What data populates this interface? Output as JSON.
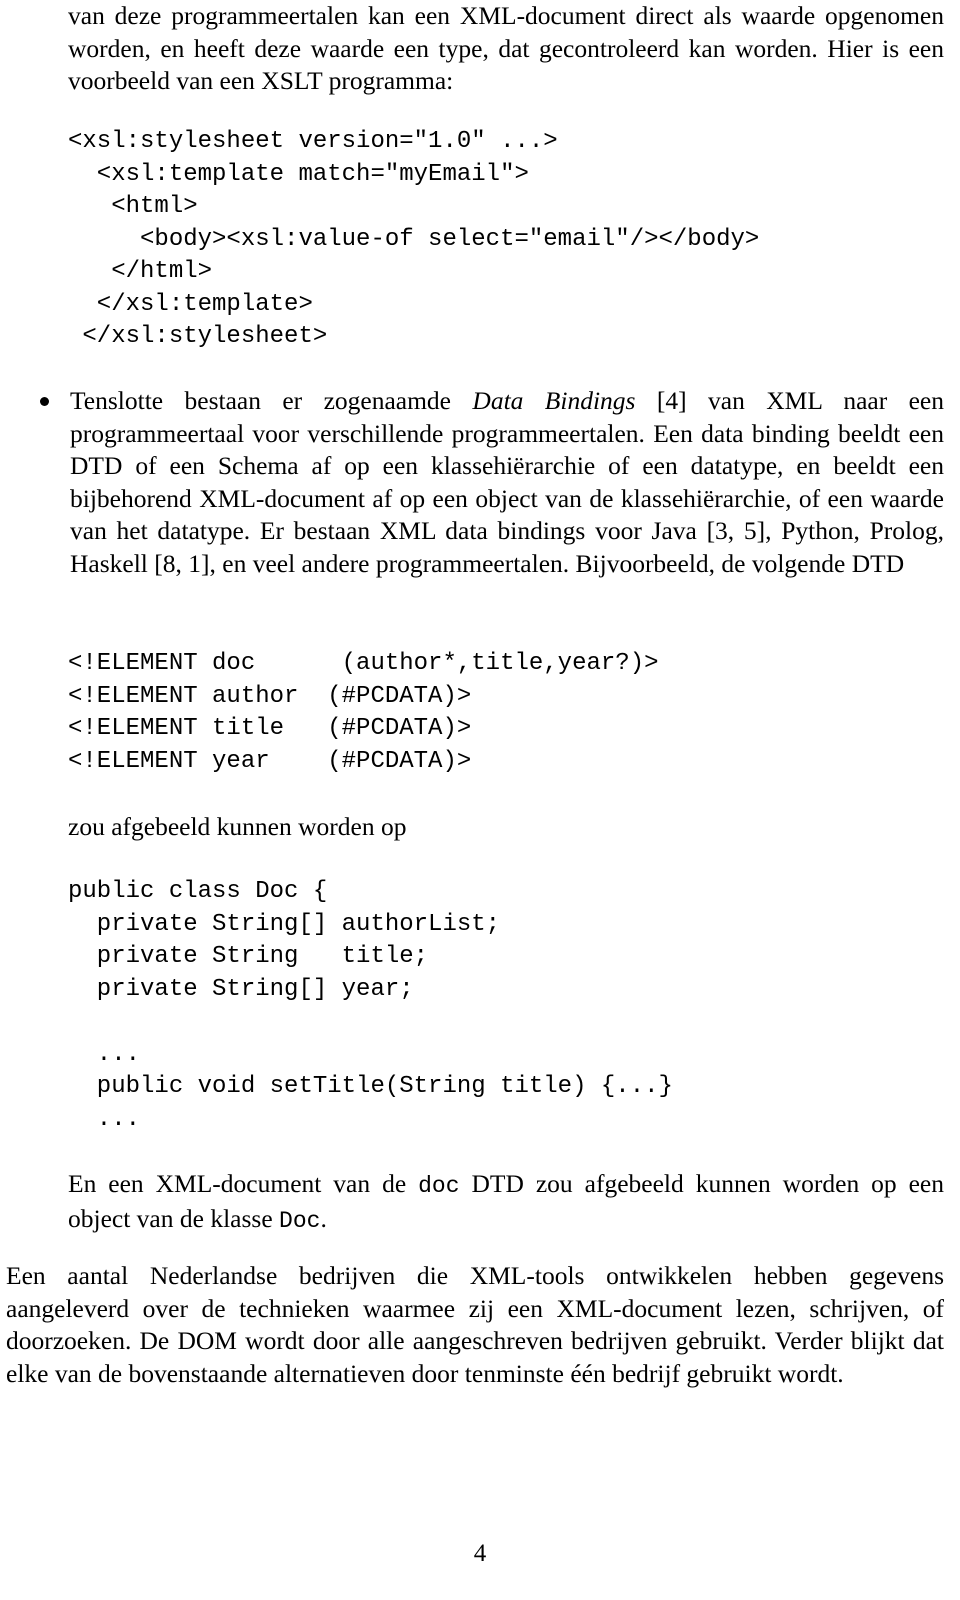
{
  "document": {
    "page_number": "4",
    "paragraph_top": "van deze programmeertalen kan een XML-document direct als waarde opgenomen worden, en heeft deze waarde een type, dat gecontroleerd kan worden.  Hier is een voorbeeld van een XSLT programma:",
    "code_xslt": "<xsl:stylesheet version=\"1.0\" ...>\n  <xsl:template match=\"myEmail\">\n   <html>\n     <body><xsl:value-of select=\"email\"/></body>\n   </html>\n  </xsl:template>\n </xsl:stylesheet>",
    "bullet": {
      "marker": "bullet-dot",
      "text_part1": "Tenslotte bestaan er zogenaamde ",
      "text_italic": "Data Bindings",
      "text_part2": " [4] van XML naar een programmeertaal voor verschillende programmeertalen.  Een data binding beeldt een DTD of een Schema af op een klassehiërarchie of een datatype, en beeldt een bijbehorend XML-document af op een object van de klassehiërarchie, of een waarde van het datatype.  Er bestaan XML data bindings voor Java [3, 5], Python, Prolog, Haskell [8, 1], en veel andere programmeertalen.  Bijvoorbeeld, de volgende DTD"
    },
    "code_dtd": "<!ELEMENT doc      (author*,title,year?)>\n<!ELEMENT author  (#PCDATA)>\n<!ELEMENT title   (#PCDATA)>\n<!ELEMENT year    (#PCDATA)>",
    "paragraph_zou": "zou afgebeeld kunnen worden op",
    "code_java": "public class Doc {\n  private String[] authorList;\n  private String   title;\n  private String[] year;\n\n  ...\n  public void setTitle(String title) {...}\n  ...",
    "paragraph_en_een": {
      "part1": "En een XML-document van de ",
      "mono1": "doc",
      "part2": " DTD zou afgebeeld kunnen worden op een object van de klasse ",
      "mono2": "Doc",
      "part3": "."
    },
    "paragraph_last": "Een aantal Nederlandse bedrijven die XML-tools ontwikkelen hebben gegevens aangeleverd over de technieken waarmee zij een XML-document lezen, schrijven, of doorzoeken.  De DOM wordt door alle aangeschreven bedrijven gebruikt.  Verder blijkt dat elke van de bovenstaande alternatieven door tenminste één bedrijf gebruikt wordt."
  }
}
